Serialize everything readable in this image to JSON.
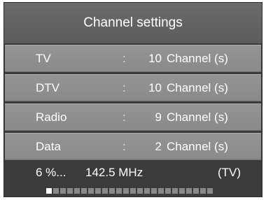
{
  "title": "Channel settings",
  "rows": [
    {
      "name": "TV",
      "colon": ":",
      "count": "10",
      "unit": "Channel (s)"
    },
    {
      "name": "DTV",
      "colon": ":",
      "count": "10",
      "unit": "Channel (s)"
    },
    {
      "name": "Radio",
      "colon": ":",
      "count": "9",
      "unit": "Channel (s)"
    },
    {
      "name": "Data",
      "colon": ":",
      "count": "2",
      "unit": "Channel (s)"
    }
  ],
  "status": {
    "percent_text": "6  %...",
    "frequency_text": "142.5  MHz",
    "type_text": "(TV)",
    "progress_fraction": 0.06,
    "progress_segments": 24
  },
  "colors": {
    "background": "#3b3b3b",
    "row": "#8f8f8f",
    "title_bar": "#636363",
    "progress_done": "#ffffff",
    "progress_todo": "#8a8a8a"
  }
}
